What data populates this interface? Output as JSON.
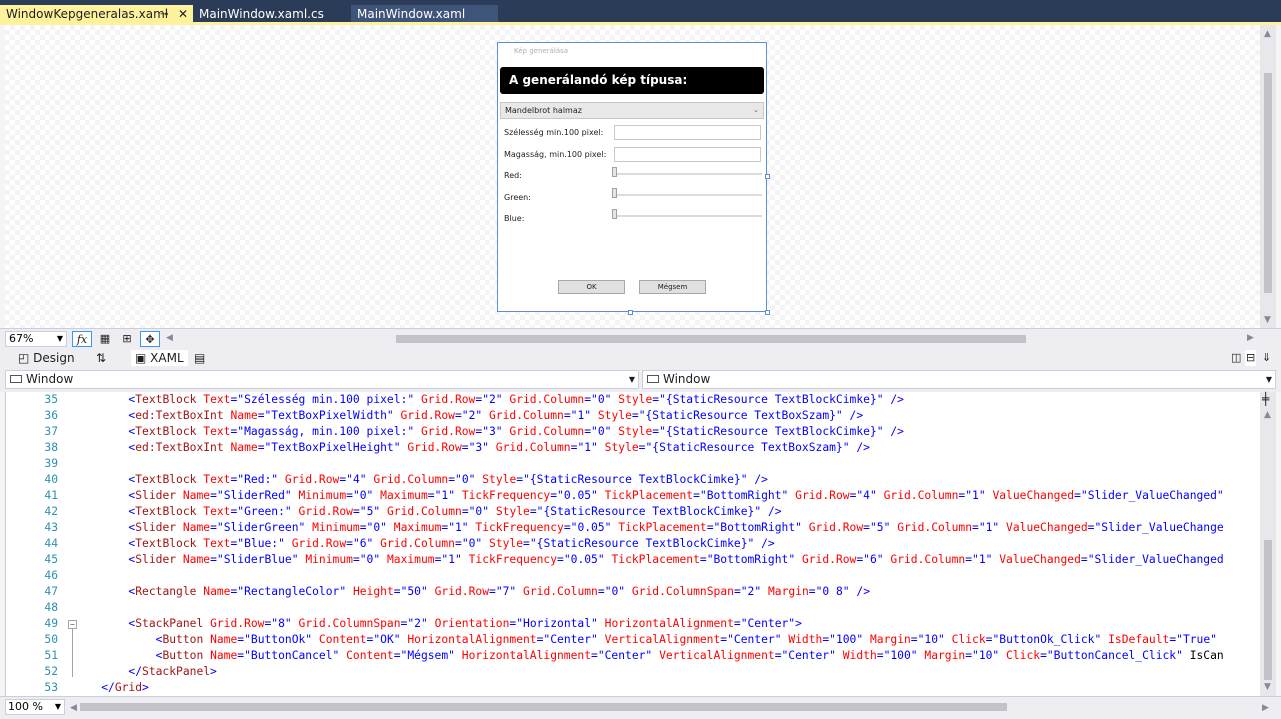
{
  "tabs": [
    {
      "label": "WindowKepgeneralas.xaml",
      "active": true
    },
    {
      "label": "MainWindow.xaml.cs",
      "active": false
    },
    {
      "label": "MainWindow.xaml",
      "active": false
    }
  ],
  "preview": {
    "window_title": "Kép generálása",
    "header": "A generálandó kép típusa:",
    "combo_value": "Mandelbrot halmaz",
    "width_label": "Szélesség min.100 pixel:",
    "height_label": "Magasság, min.100 pixel:",
    "red_label": "Red:",
    "green_label": "Green:",
    "blue_label": "Blue:",
    "ok_label": "OK",
    "cancel_label": "Mégsem"
  },
  "designer_toolbar": {
    "zoom": "67%",
    "fx_label": "fx"
  },
  "split_tabs": {
    "design_label": "Design",
    "swap_icon": "⇅",
    "xaml_label": "XAML"
  },
  "nav": {
    "left_scope": "Window",
    "right_scope": "Window"
  },
  "editor": {
    "zoom": "100 %",
    "lines": [
      {
        "n": "35",
        "text": "        <TextBlock Text=\"Szélesség min.100 pixel:\" Grid.Row=\"2\" Grid.Column=\"0\" Style=\"{StaticResource TextBlockCimke}\" />"
      },
      {
        "n": "36",
        "text": "        <ed:TextBoxInt Name=\"TextBoxPixelWidth\" Grid.Row=\"2\" Grid.Column=\"1\" Style=\"{StaticResource TextBoxSzam}\" />"
      },
      {
        "n": "37",
        "text": "        <TextBlock Text=\"Magasság, min.100 pixel:\" Grid.Row=\"3\" Grid.Column=\"0\" Style=\"{StaticResource TextBlockCimke}\" />"
      },
      {
        "n": "38",
        "text": "        <ed:TextBoxInt Name=\"TextBoxPixelHeight\" Grid.Row=\"3\" Grid.Column=\"1\" Style=\"{StaticResource TextBoxSzam}\" />"
      },
      {
        "n": "39",
        "text": ""
      },
      {
        "n": "40",
        "text": "        <TextBlock Text=\"Red:\" Grid.Row=\"4\" Grid.Column=\"0\" Style=\"{StaticResource TextBlockCimke}\" />"
      },
      {
        "n": "41",
        "text": "        <Slider Name=\"SliderRed\" Minimum=\"0\" Maximum=\"1\" TickFrequency=\"0.05\" TickPlacement=\"BottomRight\" Grid.Row=\"4\" Grid.Column=\"1\" ValueChanged=\"Slider_ValueChanged\""
      },
      {
        "n": "42",
        "text": "        <TextBlock Text=\"Green:\" Grid.Row=\"5\" Grid.Column=\"0\" Style=\"{StaticResource TextBlockCimke}\" />"
      },
      {
        "n": "43",
        "text": "        <Slider Name=\"SliderGreen\" Minimum=\"0\" Maximum=\"1\" TickFrequency=\"0.05\" TickPlacement=\"BottomRight\" Grid.Row=\"5\" Grid.Column=\"1\" ValueChanged=\"Slider_ValueChange"
      },
      {
        "n": "44",
        "text": "        <TextBlock Text=\"Blue:\" Grid.Row=\"6\" Grid.Column=\"0\" Style=\"{StaticResource TextBlockCimke}\" />"
      },
      {
        "n": "45",
        "text": "        <Slider Name=\"SliderBlue\" Minimum=\"0\" Maximum=\"1\" TickFrequency=\"0.05\" TickPlacement=\"BottomRight\" Grid.Row=\"6\" Grid.Column=\"1\" ValueChanged=\"Slider_ValueChanged"
      },
      {
        "n": "46",
        "text": ""
      },
      {
        "n": "47",
        "text": "        <Rectangle Name=\"RectangleColor\" Height=\"50\" Grid.Row=\"7\" Grid.Column=\"0\" Grid.ColumnSpan=\"2\" Margin=\"0 8\" />"
      },
      {
        "n": "48",
        "text": ""
      },
      {
        "n": "49",
        "text": "        <StackPanel Grid.Row=\"8\" Grid.ColumnSpan=\"2\" Orientation=\"Horizontal\" HorizontalAlignment=\"Center\">"
      },
      {
        "n": "50",
        "text": "            <Button Name=\"ButtonOk\" Content=\"OK\" HorizontalAlignment=\"Center\" VerticalAlignment=\"Center\" Width=\"100\" Margin=\"10\" Click=\"ButtonOk_Click\" IsDefault=\"True\""
      },
      {
        "n": "51",
        "text": "            <Button Name=\"ButtonCancel\" Content=\"Mégsem\" HorizontalAlignment=\"Center\" VerticalAlignment=\"Center\" Width=\"100\" Margin=\"10\" Click=\"ButtonCancel_Click\" IsCan"
      },
      {
        "n": "52",
        "text": "        </StackPanel>"
      },
      {
        "n": "53",
        "text": "    </Grid>"
      }
    ]
  },
  "colors": {
    "tab_active": "#fff29d",
    "tab_bar": "#2b3c59",
    "xml_tag": "#a31515",
    "xml_attr": "#ff0000",
    "xml_value": "#0000ff",
    "line_number": "#2b91af"
  }
}
